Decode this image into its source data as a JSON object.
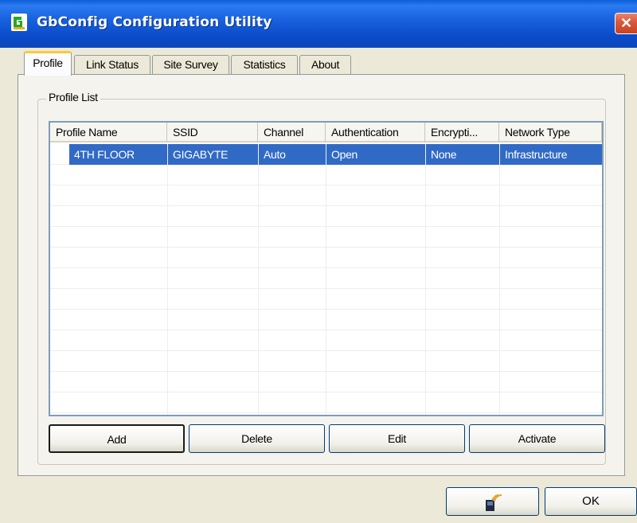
{
  "window": {
    "title": "GbConfig Configuration Utility",
    "close_glyph": "✕",
    "app_icon": "gigabyte-app-icon"
  },
  "tabs": [
    {
      "label": "Profile",
      "active": true
    },
    {
      "label": "Link Status",
      "active": false
    },
    {
      "label": "Site Survey",
      "active": false
    },
    {
      "label": "Statistics",
      "active": false
    },
    {
      "label": "About",
      "active": false
    }
  ],
  "profile_list": {
    "group_label": "Profile List",
    "columns": [
      "Profile Name",
      "SSID",
      "Channel",
      "Authentication",
      "Encrypti...",
      "Network Type"
    ],
    "rows": [
      {
        "profile_name": "4TH FLOOR",
        "ssid": "GIGABYTE",
        "channel": "Auto",
        "authentication": "Open",
        "encryption": "None",
        "network_type": "Infrastructure",
        "selected": true
      }
    ]
  },
  "buttons": {
    "add": "Add",
    "delete": "Delete",
    "edit": "Edit",
    "activate": "Activate"
  },
  "footer": {
    "icon_button": "wireless-card-icon",
    "ok": "OK"
  },
  "colors": {
    "titlebar": "#0a4cc9",
    "selection": "#316ac5",
    "tab_highlight": "#ffc83c",
    "close": "#d8573a"
  }
}
